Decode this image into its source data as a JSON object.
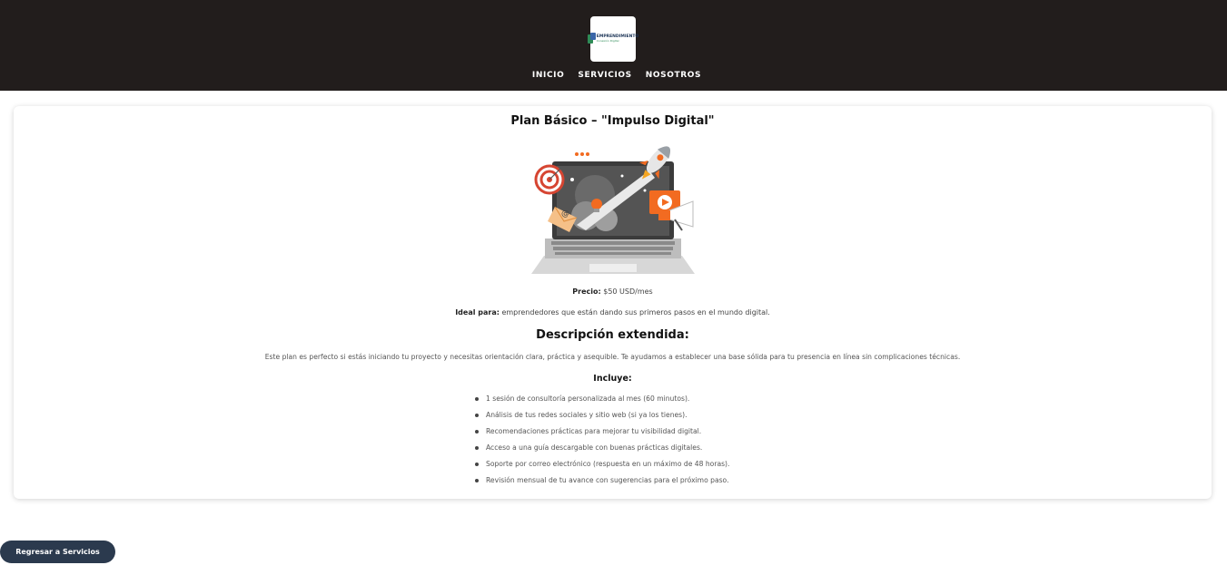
{
  "header": {
    "logo": {
      "line1": "EMPRENDIMIENTO",
      "line2": "Conexión Digital"
    },
    "nav": [
      {
        "label": "INICIO"
      },
      {
        "label": "SERVICIOS"
      },
      {
        "label": "NOSOTROS"
      }
    ]
  },
  "plan": {
    "title": "Plan Básico – \"Impulso Digital\"",
    "price_label": "Precio:",
    "price_value": " $50 USD/mes",
    "ideal_label": "Ideal para:",
    "ideal_value": " emprendedores que están dando sus primeros pasos en el mundo digital.",
    "description_title": "Descripción extendida:",
    "description_text": "Este plan es perfecto si estás iniciando tu proyecto y necesitas orientación clara, práctica y asequible. Te ayudamos a establecer una base sólida para tu presencia en línea sin complicaciones técnicas.",
    "includes_title": "Incluye:",
    "includes": [
      "1 sesión de consultoría personalizada al mes (60 minutos).",
      "Análisis de tus redes sociales y sitio web (si ya los tienes).",
      "Recomendaciones prácticas para mejorar tu visibilidad digital.",
      "Acceso a una guía descargable con buenas prácticas digitales.",
      "Soporte por correo electrónico (respuesta en un máximo de 48 horas).",
      "Revisión mensual de tu avance con sugerencias para el próximo paso."
    ]
  },
  "back_button": {
    "label": "Regresar a Servicios"
  },
  "colors": {
    "header_bg": "#221d1c",
    "button_bg": "#2b3a4e",
    "accent_orange": "#f26b21"
  }
}
